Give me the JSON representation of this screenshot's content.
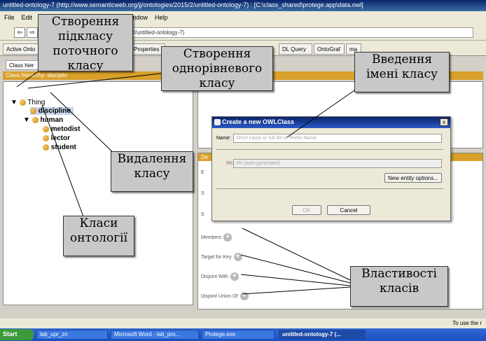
{
  "window": {
    "title": "untitled-ontology-7 (http://www.semanticweb.org/jj/ontologies/2015/2/untitled-ontology-7) : [C:\\class_shared\\protege.app\\data.owl]"
  },
  "menu": [
    "File",
    "Edit",
    "r",
    "Window",
    "Help"
  ],
  "address": {
    "url": "semanticweb.org/jj/ontologies/2015/2/untitled-ontology-7)"
  },
  "tabs": [
    "Active Onto",
    "Properties",
    "DL Query",
    "OntoGraf",
    "ma"
  ],
  "subtab": {
    "label": "Class hier"
  },
  "class_hierarchy": {
    "header": "Class hierarchy: disciplin"
  },
  "tree": {
    "root": "Thing",
    "discipline": "discipline",
    "human": "human",
    "metodist": "metodist",
    "lector": "lector",
    "student": "student"
  },
  "dialog": {
    "title": "Create a new OWLClass",
    "close": "x",
    "name_label": "Name:",
    "name_placeholder": "Short name or full IRI or Prefix-Name",
    "iri_label": "IRI:",
    "iri_placeholder": "IRI (auto-generated)",
    "entity_options": "New entity options...",
    "ok": "OK",
    "cancel": "Cancel"
  },
  "description": {
    "header": "De",
    "letters": [
      "E",
      "S",
      "S"
    ],
    "members": "Members",
    "target_for_key": "Target for Key",
    "disjoint_with": "Disjoint With",
    "disjoint_union_of": "Disjoint Union Of",
    "plus": "+"
  },
  "status": {
    "text": "To use the r"
  },
  "taskbar": {
    "start": "Start",
    "items": [
      "lab_upr_zn",
      "Microsoft Word - lab_pro...",
      "Protege.exe",
      "untitled-ontology-7 (..."
    ]
  },
  "callouts": {
    "subclass": "Створення підкласу поточного класу",
    "sibling": "Створення однорівневого класу",
    "name_entry": "Введення імені класу",
    "delete": "Видалення класу",
    "ontology_classes": "Класи онтології",
    "properties": "Властивості класів"
  },
  "colors": {
    "accent": "#d9a02a",
    "title": "#0a246a",
    "callout_bg": "#c8c8c8"
  }
}
